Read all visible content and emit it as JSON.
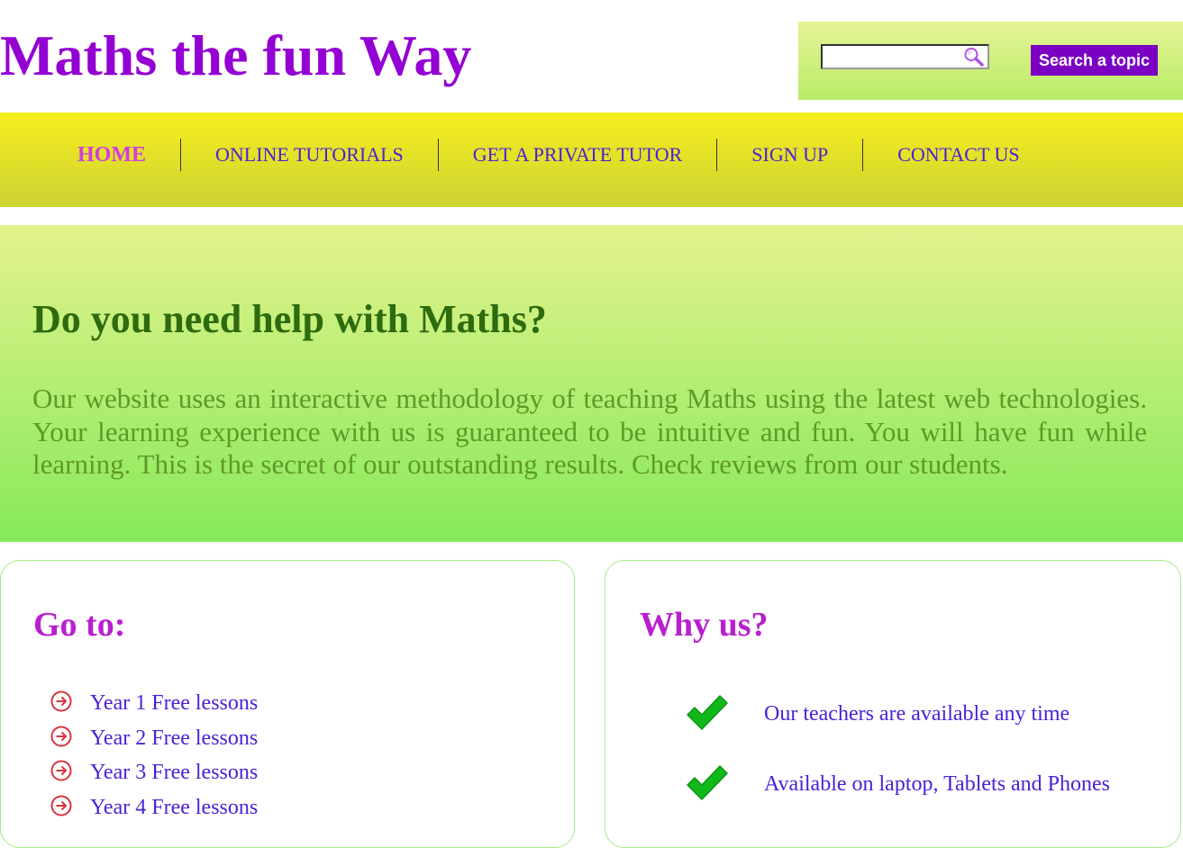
{
  "header": {
    "title": "Maths the fun Way",
    "search": {
      "value": "",
      "placeholder": "",
      "button_label": "Search a topic"
    }
  },
  "nav": {
    "items": [
      {
        "label": "HOME",
        "active": true
      },
      {
        "label": "ONLINE TUTORIALS",
        "active": false
      },
      {
        "label": "GET A PRIVATE TUTOR",
        "active": false
      },
      {
        "label": "SIGN UP",
        "active": false
      },
      {
        "label": "CONTACT US",
        "active": false
      }
    ]
  },
  "hero": {
    "title": "Do you need help with Maths?",
    "text": "Our website uses an interactive methodology of teaching Maths using the latest web technologies. Your learning experience with us is guaranteed to be intuitive and fun. You will have fun while learning. This is the secret of our outstanding results. Check reviews from our students."
  },
  "goto": {
    "title": "Go to:",
    "items": [
      "Year 1 Free lessons",
      "Year 2 Free lessons",
      "Year 3 Free lessons",
      "Year 4 Free lessons"
    ]
  },
  "why": {
    "title": "Why us?",
    "items": [
      "Our teachers are available any time",
      "Available on laptop, Tablets and Phones"
    ]
  },
  "icons": {
    "search": "magnifier-icon",
    "list_bullet": "circle-arrow-right-icon",
    "check": "check-icon"
  },
  "colors": {
    "title_purple": "#9400d3",
    "nav_link": "#4b1fd6",
    "nav_active": "#d13ce0",
    "hero_title": "#2e6a0e",
    "hero_text": "#5d9a27",
    "panel_title": "#b81fcf",
    "search_button": "#7b00c4",
    "bullet_red": "#d9343f",
    "check_green": "#12b81a"
  }
}
